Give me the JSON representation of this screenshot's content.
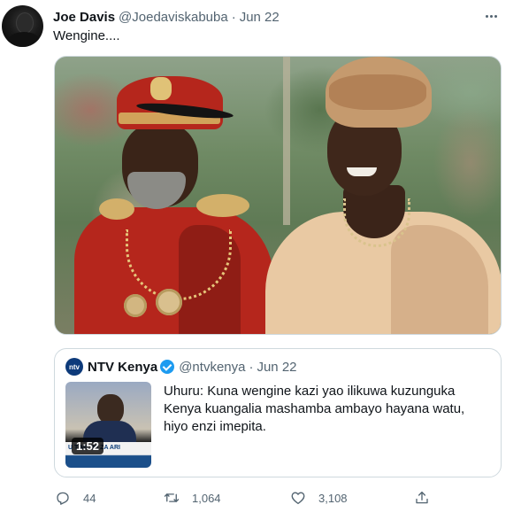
{
  "tweet": {
    "author_name": "Joe Davis",
    "author_handle": "@Joedaviskabuba",
    "separator": "·",
    "date": "Jun 22",
    "text": "Wengine....",
    "more_icon": "more-horizontal-icon"
  },
  "quoted_tweet": {
    "author_name": "NTV Kenya",
    "avatar_text": "ntv",
    "verified": true,
    "author_handle": "@ntvkenya",
    "separator": "·",
    "date": "Jun 22",
    "text": "Uhuru: Kuna wengine kazi yao ilikuwa kuzunguka Kenya kuangalia mashamba ambayo hayana watu, hiyo enzi imepita.",
    "video": {
      "duration": "1:52",
      "banner_text": "U  TIMILIKI ZA ARI"
    }
  },
  "actions": {
    "reply_count": "44",
    "retweet_count": "1,064",
    "like_count": "3,108"
  },
  "colors": {
    "text_primary": "#0f1419",
    "text_secondary": "#536471",
    "border": "#cfd9de",
    "verified_blue": "#1d9bf0"
  }
}
